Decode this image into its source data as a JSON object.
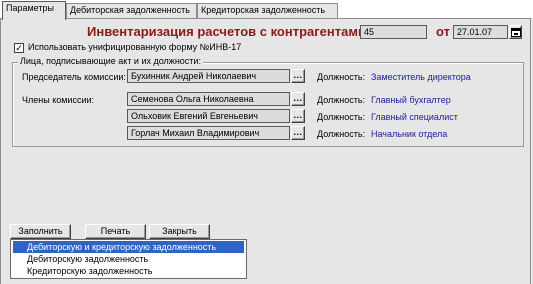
{
  "tabs": [
    {
      "label": "Параметры",
      "active": true
    },
    {
      "label": "Дебиторская задолженность",
      "active": false
    },
    {
      "label": "Кредиторская задолженность",
      "active": false
    }
  ],
  "header": {
    "title": "Инвентаризация расчетов с контрагентами №",
    "number": "45",
    "date_label": "от",
    "date": "27.01.07"
  },
  "unified_form": {
    "label": "Использовать унифицированную форму №ИНВ-17",
    "checked": true
  },
  "signers": {
    "group_title": "Лица, подписывающие акт и их должности:",
    "chairman_label": "Председатель комиссии:",
    "members_label": "Члены комиссии:",
    "position_label": "Должность:",
    "chairman": {
      "name": "Бухинник Андрей Николаевич",
      "position": "Заместитель директора"
    },
    "members": [
      {
        "name": "Семенова Ольга Николаевна",
        "position": "Главный бухгалтер"
      },
      {
        "name": "Ольховик Евгений Евгеньевич",
        "position": "Главный специалист"
      },
      {
        "name": "Горлач Михаил Владимирович",
        "position": "Начальник отдела"
      }
    ],
    "select_button": "..."
  },
  "buttons": {
    "fill": "Заполнить",
    "print": "Печать",
    "close": "Закрыть"
  },
  "fill_menu": {
    "items": [
      "Дебиторскую и кредиторскую задолженность",
      "Дебиторскую задолженность",
      "Кредиторскую задолженность"
    ],
    "selected": 0
  },
  "icons": {
    "calendar_button": "calendar-icon",
    "checkbox": "checkmark-icon"
  },
  "colors": {
    "title": "#8b1a1a",
    "position_text": "#1d1d9c",
    "selection": "#3163c6",
    "background": "#e6e6e6"
  }
}
